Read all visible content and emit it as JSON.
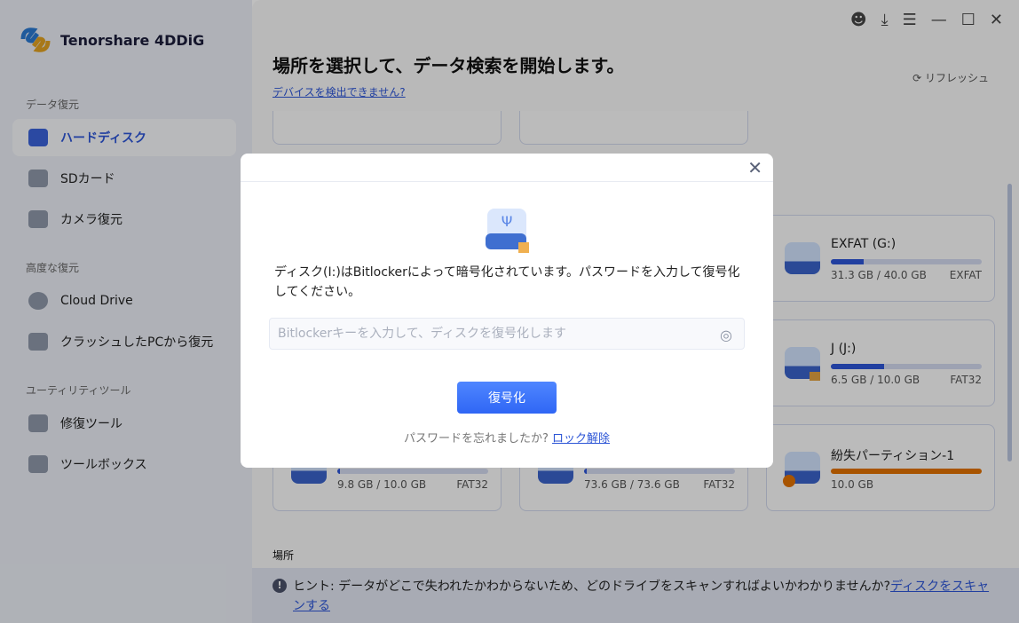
{
  "app": {
    "name": "Tenorshare 4DDiG"
  },
  "sidebar": {
    "sections": [
      {
        "label": "データ復元",
        "items": [
          {
            "label": "ハードディスク",
            "icon": "hard-disk-icon",
            "active": true
          },
          {
            "label": "SDカード",
            "icon": "sd-card-icon"
          },
          {
            "label": "カメラ復元",
            "icon": "camera-icon"
          }
        ]
      },
      {
        "label": "高度な復元",
        "items": [
          {
            "label": "Cloud Drive",
            "icon": "cloud-icon"
          },
          {
            "label": "クラッシュしたPCから復元",
            "icon": "crashed-pc-icon"
          }
        ]
      },
      {
        "label": "ユーティリティツール",
        "items": [
          {
            "label": "修復ツール",
            "icon": "repair-icon"
          },
          {
            "label": "ツールボックス",
            "icon": "toolbox-icon"
          }
        ]
      }
    ]
  },
  "main": {
    "title": "場所を選択して、データ検索を開始します。",
    "detect_link": "デバイスを検出できません?",
    "refresh": "リフレッシュ",
    "location_label": "場所",
    "drives": [
      {
        "name": "EXFAT (G:)",
        "size": "31.3 GB / 40.0 GB",
        "fs": "EXFAT",
        "used": 0.22
      },
      {
        "name": "J (J:)",
        "size": "6.5 GB / 10.0 GB",
        "fs": "FAT32",
        "used": 0.35,
        "locked": true
      },
      {
        "name": "",
        "size": "9.8 GB / 10.0 GB",
        "fs": "FAT32",
        "used": 0.02
      },
      {
        "name": "",
        "size": "73.6 GB / 73.6 GB",
        "fs": "FAT32",
        "used": 0.0
      },
      {
        "name": "紛失パーティション-1",
        "size": "10.0 GB",
        "fs": "",
        "used": 1.0,
        "lost": true
      }
    ]
  },
  "hint": {
    "text": "ヒント: データがどこで失われたかわからないため、どのドライブをスキャンすればよいかわかりませんか?",
    "link": "ディスクをスキャンする"
  },
  "modal": {
    "message": "ディスク(I:)はBitlockerによって暗号化されています。パスワードを入力して復号化してください。",
    "placeholder": "Bitlockerキーを入力して、ディスクを復号化します",
    "decrypt_button": "復号化",
    "forgot_text": "パスワードを忘れましたか?",
    "unlock_link": "ロック解除"
  },
  "colors": {
    "accent": "#2f66f5",
    "lost": "#e07000"
  }
}
